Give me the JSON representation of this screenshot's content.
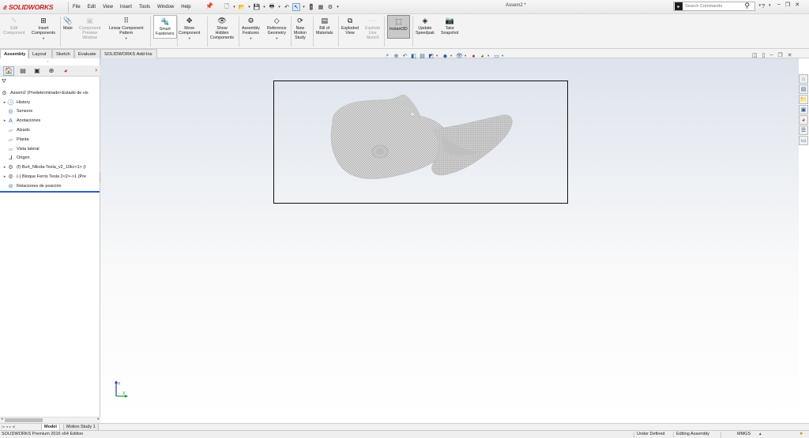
{
  "app": {
    "brand": "SOLIDWORKS",
    "document_title": "Assem2 *"
  },
  "menu": [
    "File",
    "Edit",
    "View",
    "Insert",
    "Tools",
    "Window",
    "Help"
  ],
  "search": {
    "placeholder": "Search Commands"
  },
  "command_manager": [
    {
      "label": "Edit Component",
      "lines": [
        "Edit",
        "Component"
      ],
      "disabled": true,
      "icon": "edit-component-icon"
    },
    {
      "label": "Insert Components",
      "lines": [
        "Insert",
        "Components"
      ],
      "disabled": false,
      "icon": "insert-components-icon"
    },
    {
      "label": "Mate",
      "lines": [
        "Mate"
      ],
      "disabled": false,
      "icon": "mate-icon"
    },
    {
      "label": "Component Preview Window",
      "lines": [
        "Component",
        "Preview",
        "Window"
      ],
      "disabled": true,
      "icon": "component-preview-icon"
    },
    {
      "label": "Linear Component Pattern",
      "lines": [
        "Linear Component",
        "Pattern"
      ],
      "disabled": false,
      "icon": "linear-pattern-icon"
    },
    {
      "label": "Smart Fasteners",
      "lines": [
        "Smart",
        "Fasteners"
      ],
      "disabled": false,
      "icon": "smart-fasteners-icon"
    },
    {
      "label": "Move Component",
      "lines": [
        "Move",
        "Component"
      ],
      "disabled": false,
      "icon": "move-component-icon"
    },
    {
      "label": "Show Hidden Components",
      "lines": [
        "Show",
        "Hidden",
        "Components"
      ],
      "disabled": false,
      "icon": "show-hidden-icon"
    },
    {
      "label": "Assembly Features",
      "lines": [
        "Assembly",
        "Features"
      ],
      "disabled": false,
      "icon": "assembly-features-icon"
    },
    {
      "label": "Reference Geometry",
      "lines": [
        "Reference",
        "Geometry"
      ],
      "disabled": false,
      "icon": "reference-geometry-icon"
    },
    {
      "label": "New Motion Study",
      "lines": [
        "New",
        "Motion",
        "Study"
      ],
      "disabled": false,
      "icon": "motion-study-icon"
    },
    {
      "label": "Bill of Materials",
      "lines": [
        "Bill of",
        "Materials"
      ],
      "disabled": false,
      "icon": "bill-of-materials-icon"
    },
    {
      "label": "Exploded View",
      "lines": [
        "Exploded",
        "View"
      ],
      "disabled": false,
      "icon": "exploded-view-icon"
    },
    {
      "label": "Explode Line Sketch",
      "lines": [
        "Explode",
        "Line",
        "Sketch"
      ],
      "disabled": true,
      "icon": "explode-line-icon"
    },
    {
      "label": "Instant3D",
      "lines": [
        "Instant3D"
      ],
      "disabled": false,
      "icon": "instant3d-icon"
    },
    {
      "label": "Update Speedpak",
      "lines": [
        "Update",
        "Speedpak"
      ],
      "disabled": false,
      "icon": "speedpak-icon"
    },
    {
      "label": "Take Snapshot",
      "lines": [
        "Take",
        "Snapshot"
      ],
      "disabled": false,
      "icon": "snapshot-icon"
    }
  ],
  "tabs": [
    "Assembly",
    "Layout",
    "Sketch",
    "Evaluate",
    "SOLIDWORKS Add-Ins"
  ],
  "feature_tree": [
    {
      "label": "Assem2  (Predeterminado<Estado de vis",
      "icon": "assembly-icon",
      "expandable": false
    },
    {
      "label": "History",
      "icon": "history-icon",
      "expandable": true
    },
    {
      "label": "Sensors",
      "icon": "sensors-icon",
      "expandable": false
    },
    {
      "label": "Anotaciones",
      "icon": "annotations-icon",
      "expandable": true
    },
    {
      "label": "Alzado",
      "icon": "plane-icon",
      "expandable": false
    },
    {
      "label": "Planta",
      "icon": "plane-icon",
      "expandable": false
    },
    {
      "label": "Vista lateral",
      "icon": "plane-icon",
      "expandable": false
    },
    {
      "label": "Origen",
      "icon": "origin-icon",
      "expandable": false
    },
    {
      "label": "(f) Burt_Nikola-Tesla_v2_10kc<1> (I",
      "icon": "part-icon",
      "expandable": true
    },
    {
      "label": "(-) Bloque Ferris Tesla 2<2>->1 (Pre",
      "icon": "part-icon",
      "expandable": true
    },
    {
      "label": "Relaciones de posición",
      "icon": "mates-icon",
      "expandable": false
    }
  ],
  "bottom_tabs": [
    "Model",
    "Motion Study 1"
  ],
  "status": {
    "edition": "SOLIDWORKS Premium 2016 x64 Edition",
    "definition": "Under Defined",
    "mode": "Editing Assembly",
    "units": "MMGS"
  },
  "colors": {
    "brand_red": "#cc1e1e",
    "accent_blue": "#2d62b8"
  }
}
